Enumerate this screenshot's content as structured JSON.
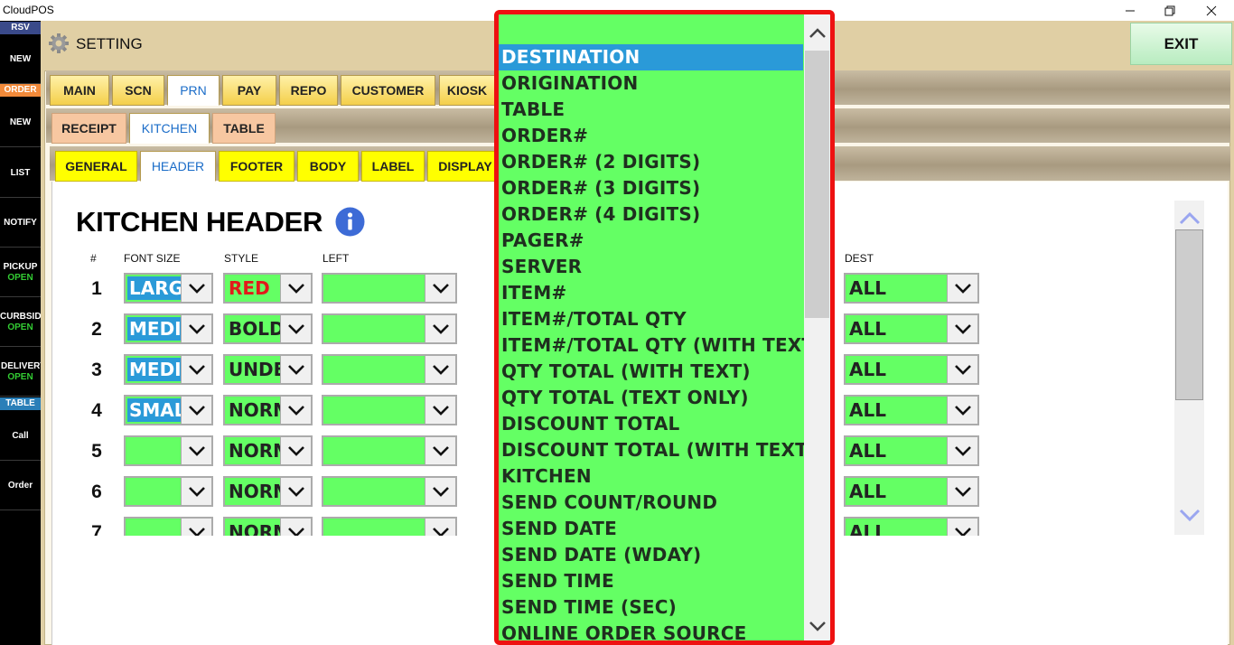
{
  "window": {
    "title": "CloudPOS"
  },
  "sidebar": {
    "tags": {
      "rsv": "RSV",
      "order": "ORDER",
      "table": "TABLE"
    },
    "items": [
      {
        "label": "NEW"
      },
      {
        "label": "NEW"
      },
      {
        "label": "LIST"
      },
      {
        "label": "NOTIFY"
      },
      {
        "label": "PICKUP",
        "sub": "OPEN"
      },
      {
        "label": "CURBSID",
        "sub": "OPEN"
      },
      {
        "label": "DELIVERY",
        "sub": "OPEN"
      },
      {
        "label": "Call"
      },
      {
        "label": "Order"
      }
    ]
  },
  "header": {
    "title": "SETTING",
    "exit_label": "EXIT"
  },
  "tabs_main": [
    "MAIN",
    "SCN",
    "PRN",
    "PAY",
    "REPO",
    "CUSTOMER",
    "KIOSK"
  ],
  "tabs_prn": [
    "RECEIPT",
    "KITCHEN",
    "TABLE"
  ],
  "tabs_kitchen": [
    "GENERAL",
    "HEADER",
    "FOOTER",
    "BODY",
    "LABEL",
    "DISPLAY"
  ],
  "page": {
    "title": "KITCHEN HEADER",
    "columns": {
      "num": "#",
      "font_size": "FONT SIZE",
      "style": "STYLE",
      "left": "LEFT",
      "dest": "DEST"
    },
    "rows": [
      {
        "num": "1",
        "font_size": "LARGE",
        "style": "RED",
        "left": "",
        "dest": "ALL"
      },
      {
        "num": "2",
        "font_size": "MEDIUM",
        "style": "BOLD",
        "left": "",
        "dest": "ALL"
      },
      {
        "num": "3",
        "font_size": "MEDIUM",
        "style": "UNDERLINE",
        "left": "",
        "dest": "ALL"
      },
      {
        "num": "4",
        "font_size": "SMALL",
        "style": "NORMAL",
        "left": "",
        "dest": "ALL"
      },
      {
        "num": "5",
        "font_size": "",
        "style": "NORMAL",
        "left": "",
        "dest": "ALL"
      },
      {
        "num": "6",
        "font_size": "",
        "style": "NORMAL",
        "left": "",
        "dest": "ALL"
      },
      {
        "num": "7",
        "font_size": "",
        "style": "NORMAL",
        "left": "",
        "dest": "ALL"
      }
    ]
  },
  "dropdown": {
    "selected": "DESTINATION",
    "options": [
      "DESTINATION",
      "ORIGINATION",
      "TABLE",
      "ORDER#",
      "ORDER# (2 DIGITS)",
      "ORDER# (3 DIGITS)",
      "ORDER# (4 DIGITS)",
      "PAGER#",
      "SERVER",
      "ITEM#",
      "ITEM#/TOTAL QTY",
      "ITEM#/TOTAL QTY (WITH TEXT)",
      "QTY TOTAL (WITH TEXT)",
      "QTY TOTAL (TEXT ONLY)",
      "DISCOUNT TOTAL",
      "DISCOUNT TOTAL (WITH TEXT)",
      "KITCHEN",
      "SEND COUNT/ROUND",
      "SEND DATE",
      "SEND DATE (WDAY)",
      "SEND TIME",
      "SEND TIME (SEC)",
      "ONLINE ORDER SOURCE"
    ]
  },
  "colors": {
    "combo_bg": "#64ff64",
    "selection": "#2a9ad8",
    "highlight_border": "#ee1111",
    "header_bg": "#e0cfa4",
    "sidebar_bg": "#000000"
  }
}
